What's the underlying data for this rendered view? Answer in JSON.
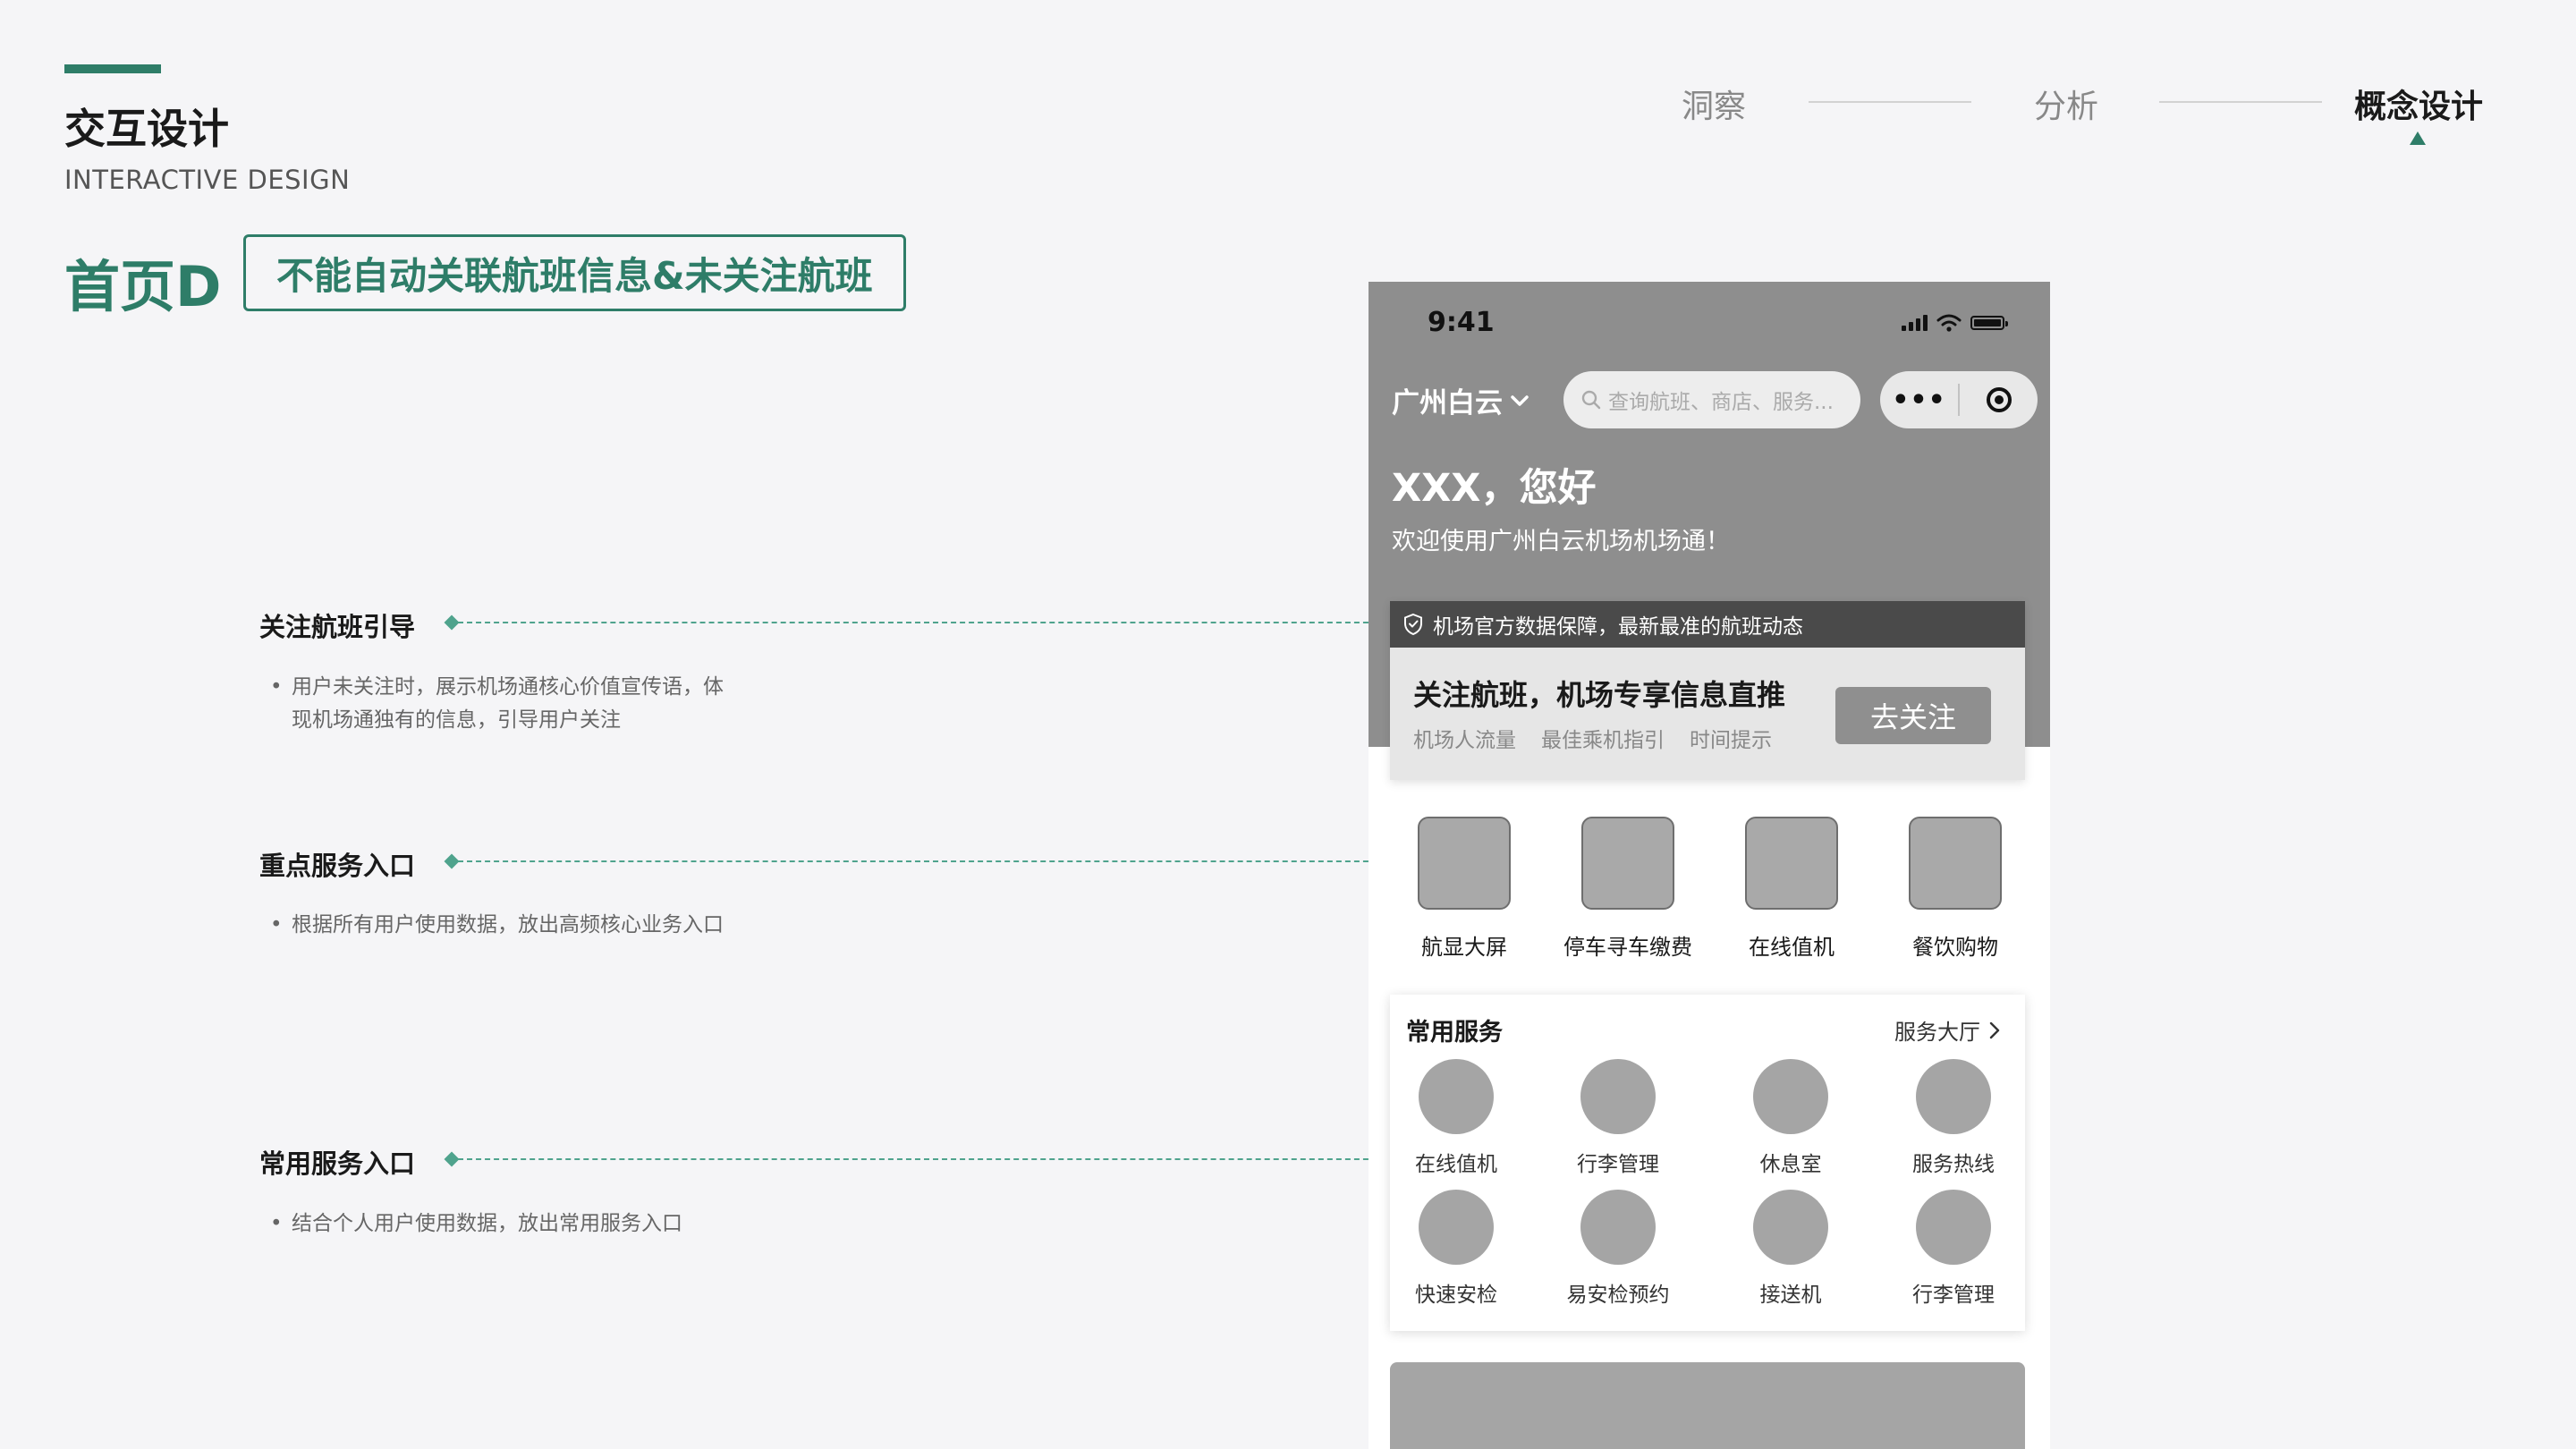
{
  "colors": {
    "accent": "#2e7d68",
    "background": "#f5f5f7",
    "phone_header": "#8e8e8e",
    "annotation_line": "#4fa38d"
  },
  "header": {
    "title": "交互设计",
    "subtitle": "INTERACTIVE DESIGN",
    "page_name": "首页D",
    "page_tag": "不能自动关联航班信息&未关注航班"
  },
  "stepper": {
    "steps": [
      {
        "label": "洞察",
        "active": false
      },
      {
        "label": "分析",
        "active": false
      },
      {
        "label": "概念设计",
        "active": true
      }
    ]
  },
  "annotations": [
    {
      "title": "关注航班引导",
      "desc": "用户未关注时，展示机场通核心价值宣传语，体现机场通独有的信息，引导用户关注"
    },
    {
      "title": "重点服务入口",
      "desc": "根据所有用户使用数据，放出高频核心业务入口"
    },
    {
      "title": "常用服务入口",
      "desc": "结合个人用户使用数据，放出常用服务入口"
    }
  ],
  "phone": {
    "status_time": "9:41",
    "status_icons": [
      "signal-icon",
      "wifi-icon",
      "battery-icon"
    ],
    "city": "广州白云",
    "search_placeholder": "查询航班、商店、服务...",
    "capsule_more": "•••",
    "greeting": "XXX，您好",
    "welcome": "欢迎使用广州白云机场机场通！",
    "follow_card": {
      "banner": "机场官方数据保障，最新最准的航班动态",
      "title": "关注航班，机场专享信息直推",
      "features": [
        "机场人流量",
        "最佳乘机指引",
        "时间提示"
      ],
      "button": "去关注"
    },
    "key_services": [
      "航显大屏",
      "停车寻车缴费",
      "在线值机",
      "餐饮购物"
    ],
    "common_services": {
      "title": "常用服务",
      "link": "服务大厅",
      "row1": [
        "在线值机",
        "行李管理",
        "休息室",
        "服务热线"
      ],
      "row2": [
        "快速安检",
        "易安检预约",
        "接送机",
        "行李管理"
      ]
    }
  }
}
